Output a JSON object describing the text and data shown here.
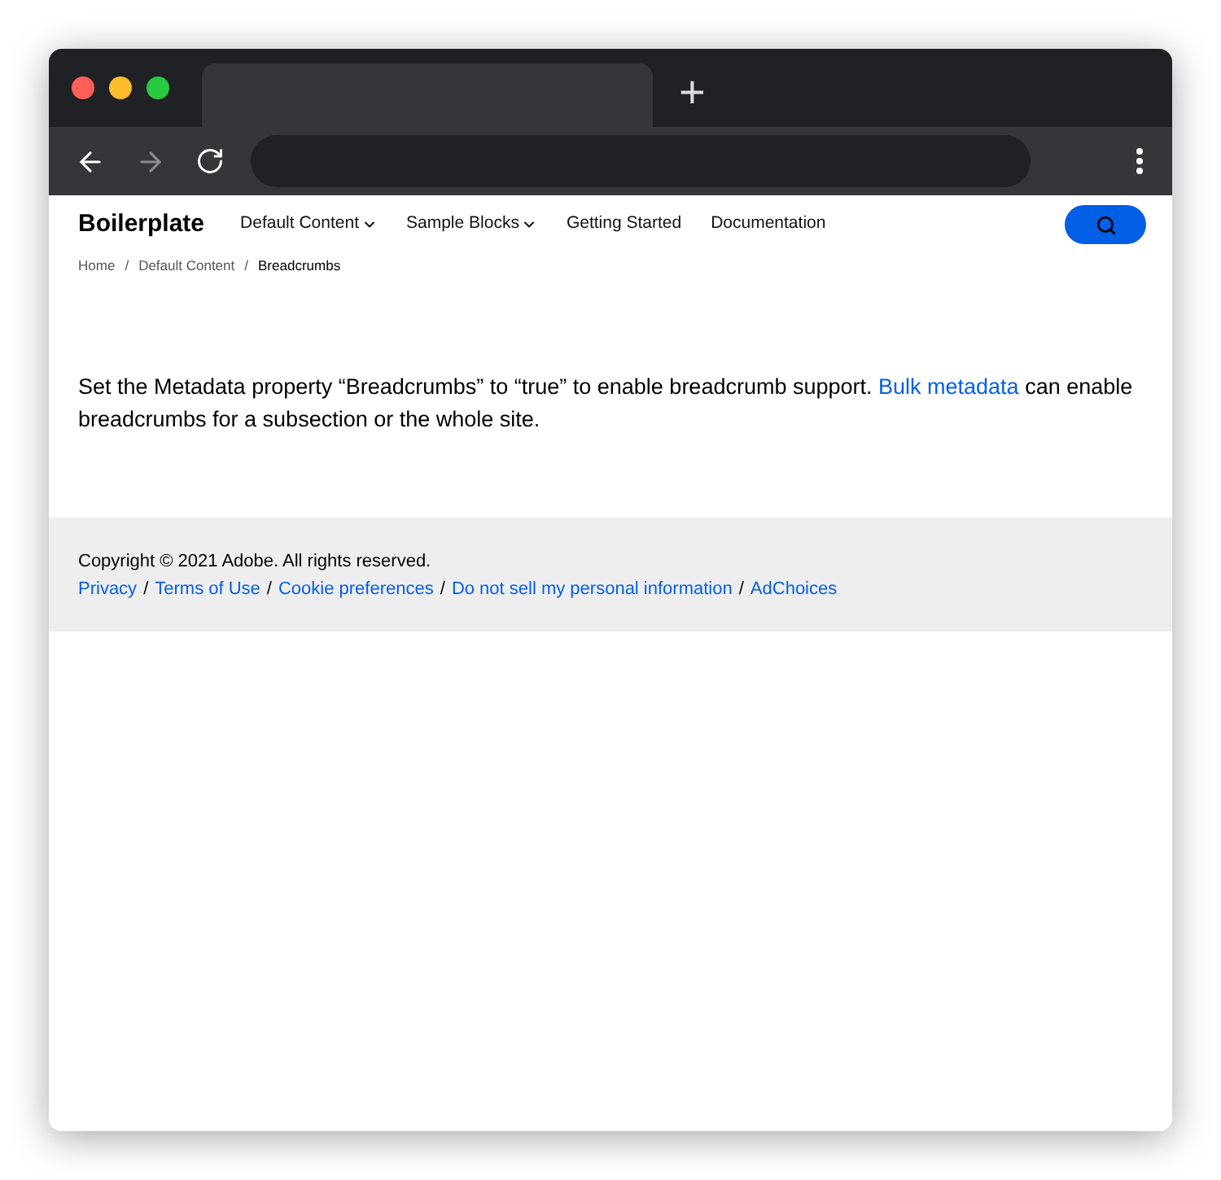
{
  "browser": {
    "new_tab": "+"
  },
  "site": {
    "brand": "Boilerplate",
    "nav": [
      {
        "label": "Default Content",
        "kind": "dropdown"
      },
      {
        "label": "Sample Blocks",
        "kind": "dropdown"
      },
      {
        "label": "Getting Started",
        "kind": "link"
      },
      {
        "label": "Documentation",
        "kind": "link"
      }
    ],
    "breadcrumbs": {
      "separator": "/",
      "items": [
        {
          "label": "Home",
          "current": false
        },
        {
          "label": "Default Content",
          "current": false
        },
        {
          "label": "Breadcrumbs",
          "current": true
        }
      ]
    },
    "paragraph": {
      "before": "Set the Metadata property “Breadcrumbs” to “true” to enable breadcrumb support. ",
      "link": "Bulk metadata",
      "after": " can enable breadcrumbs for a subsection or the whole site."
    },
    "footer": {
      "copyright": "Copyright © 2021 Adobe. All rights reserved.",
      "separator": "/",
      "links": [
        "Privacy",
        "Terms of Use",
        "Cookie preferences",
        "Do not sell my personal information",
        "AdChoices"
      ]
    }
  }
}
